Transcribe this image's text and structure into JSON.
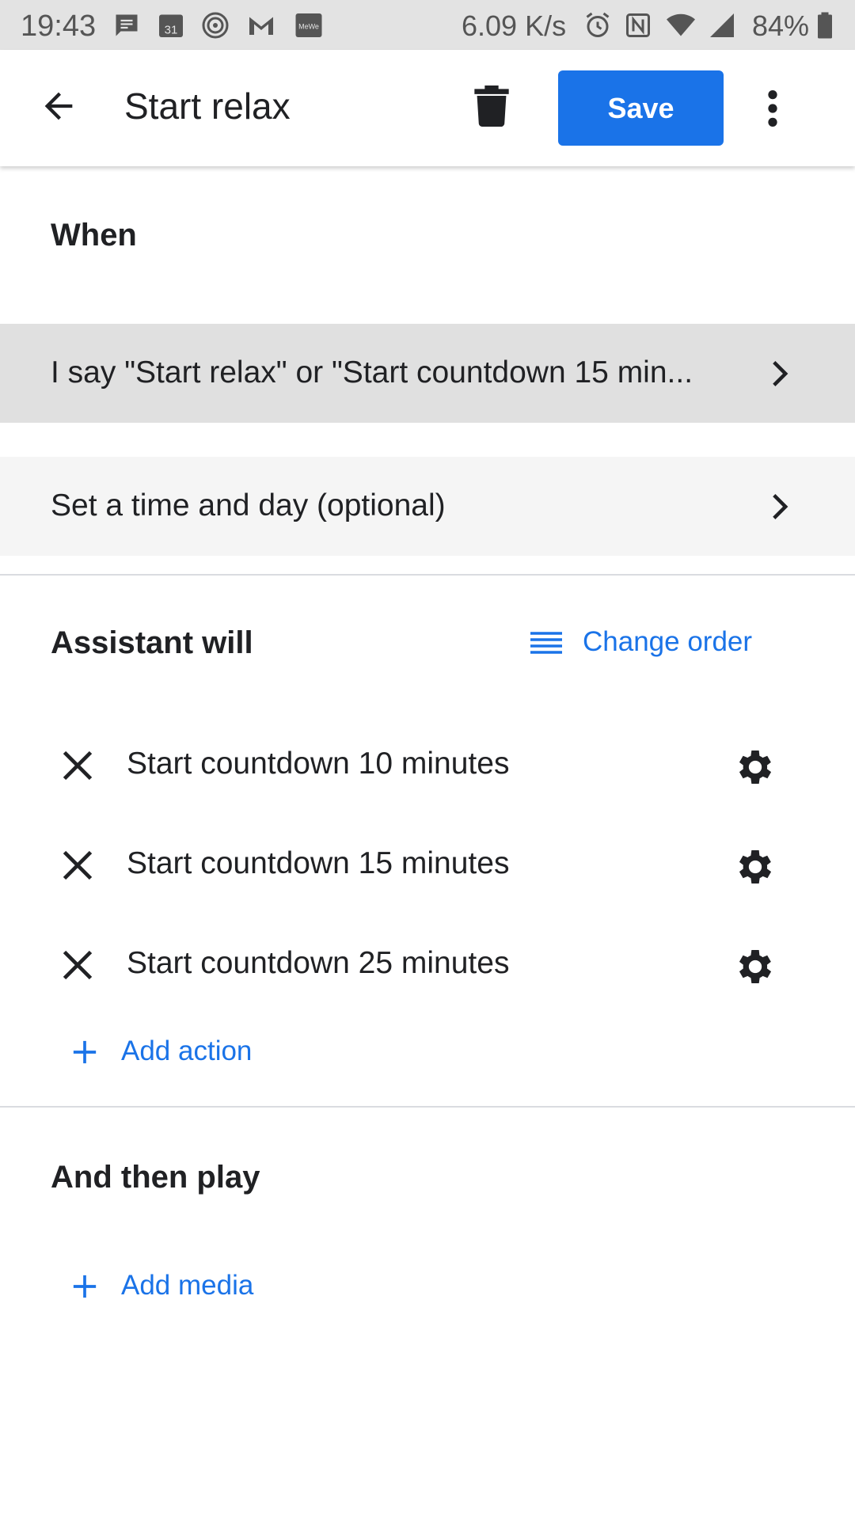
{
  "status_bar": {
    "time": "19:43",
    "icons": [
      "message-icon",
      "calendar-icon",
      "hotspot-icon",
      "gmail-icon",
      "mewe-icon"
    ],
    "calendar_day": "31",
    "mewe_text": "MeWe",
    "network_speed": "6.09 K/s",
    "right_icons": [
      "alarm-icon",
      "nfc-icon",
      "wifi-icon",
      "signal-icon",
      "battery-icon"
    ],
    "battery": "84%"
  },
  "app_bar": {
    "title": "Start relax",
    "save_label": "Save",
    "icons": [
      "back-arrow-icon",
      "trash-icon",
      "more-vert-icon"
    ]
  },
  "when": {
    "title": "When",
    "trigger_phrase": "I say \"Start relax\" or \"Start countdown 15 min...",
    "time_day": "Set a time and day (optional)"
  },
  "assistant_will": {
    "title": "Assistant will",
    "change_order_label": "Change order",
    "actions": [
      {
        "label": "Start countdown 10 minutes"
      },
      {
        "label": "Start countdown 15 minutes"
      },
      {
        "label": "Start countdown 25 minutes"
      }
    ],
    "add_action_label": "Add action"
  },
  "then_play": {
    "title": "And then play",
    "add_media_label": "Add media"
  },
  "colors": {
    "accent": "#1a73e8",
    "status_bar_bg": "#e3e3e3",
    "selected_row_bg": "#e0e0e0",
    "row_bg": "#f5f5f5"
  }
}
